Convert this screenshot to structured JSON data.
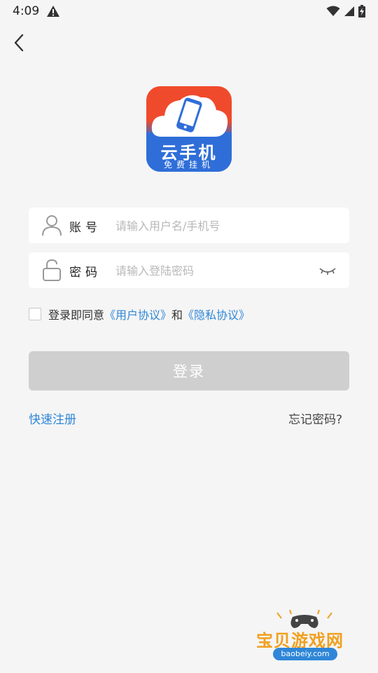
{
  "status_bar": {
    "time": "4:09",
    "icons": [
      "warning-icon",
      "wifi-icon",
      "signal-icon",
      "battery-charging-icon"
    ]
  },
  "nav": {
    "back_icon": "chevron-left-icon"
  },
  "logo": {
    "main_text": "云手机",
    "sub_text": "免费挂机",
    "colors": {
      "top": "#f04a2c",
      "bottom": "#2f6ed8"
    }
  },
  "form": {
    "account": {
      "label": "账号",
      "placeholder": "请输入用户名/手机号",
      "value": "",
      "icon": "user-icon"
    },
    "password": {
      "label": "密码",
      "placeholder": "请输入登陆密码",
      "value": "",
      "icon": "lock-icon",
      "toggle_icon": "eye-closed-icon"
    }
  },
  "agreement": {
    "checked": false,
    "prefix": "登录即同意",
    "user_agreement": "《用户协议》",
    "and": "和",
    "privacy_policy": "《隐私协议》"
  },
  "login_button": {
    "label": "登录"
  },
  "links": {
    "register": "快速注册",
    "forgot": "忘记密码?"
  },
  "watermark": {
    "title": "宝贝游戏网",
    "url": "baobeiy.com"
  },
  "colors": {
    "accent": "#2f86d8",
    "disabled_button": "#cfcfcf",
    "background": "#f5f5f5"
  }
}
